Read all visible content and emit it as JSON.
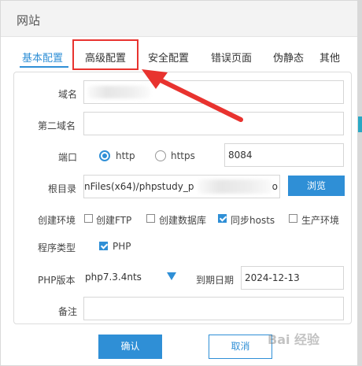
{
  "dialog": {
    "title": "网站"
  },
  "tabs": [
    "基本配置",
    "高级配置",
    "安全配置",
    "错误页面",
    "伪静态",
    "其他"
  ],
  "form": {
    "domain_label": "域名",
    "domain_value": "",
    "second_domain_label": "第二域名",
    "second_domain_value": "",
    "port_label": "端口",
    "protocol_http": "http",
    "protocol_https": "https",
    "port_value": "8084",
    "root_label": "根目录",
    "root_value": "nFiles(x64)/phpstudy_p",
    "root_value_tail": "o",
    "browse_label": "浏览",
    "env_label": "创建环境",
    "env_options": [
      "创建FTP",
      "创建数据库",
      "同步hosts",
      "生产环境"
    ],
    "program_label": "程序类型",
    "program_option": "PHP",
    "php_version_label": "PHP版本",
    "php_version_value": "php7.3.4nts",
    "expire_label": "到期日期",
    "expire_value": "2024-12-13",
    "note_label": "备注",
    "note_value": ""
  },
  "buttons": {
    "ok": "确认",
    "cancel": "取消"
  },
  "watermark": "Bai 经验",
  "colors": {
    "accent": "#2f8fd6",
    "highlight": "#e8332f"
  }
}
